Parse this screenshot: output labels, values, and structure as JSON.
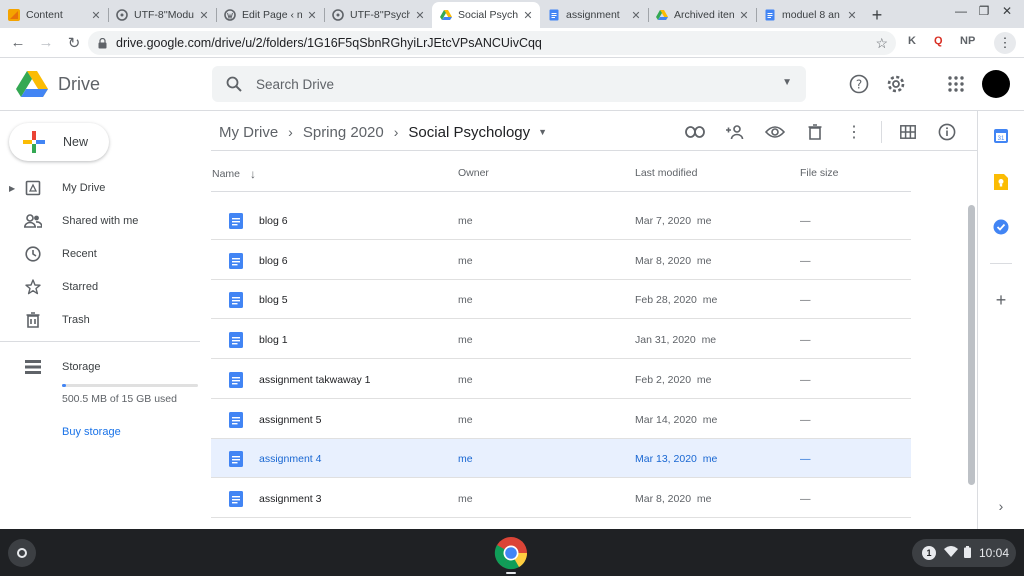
{
  "browser": {
    "tabs": [
      {
        "title": "Content",
        "icon": "sketch-icon",
        "active": false
      },
      {
        "title": "UTF-8''Modu",
        "icon": "canvas-icon",
        "active": false
      },
      {
        "title": "Edit Page ‹ n",
        "icon": "wordpress-icon",
        "active": false
      },
      {
        "title": "UTF-8''Psych",
        "icon": "canvas-icon",
        "active": false
      },
      {
        "title": "Social Psych",
        "icon": "drive-icon",
        "active": true
      },
      {
        "title": "assignment",
        "icon": "docs-icon",
        "active": false
      },
      {
        "title": "Archived iten",
        "icon": "drive-icon",
        "active": false
      },
      {
        "title": "moduel 8 an",
        "icon": "docs-icon",
        "active": false
      }
    ],
    "new_tab": "+",
    "url": "drive.google.com/drive/u/2/folders/1G16F5qSbnRGhyiLrJEtcVPsANCUivCqq",
    "extensions": [
      "K",
      "Q",
      "NP"
    ]
  },
  "drive": {
    "logo_text": "Drive",
    "search_placeholder": "Search Drive",
    "new_label": "New",
    "nav": [
      {
        "label": "My Drive",
        "icon": "my-drive-icon"
      },
      {
        "label": "Shared with me",
        "icon": "shared-icon"
      },
      {
        "label": "Recent",
        "icon": "clock-icon"
      },
      {
        "label": "Starred",
        "icon": "star-icon"
      },
      {
        "label": "Trash",
        "icon": "trash-icon"
      }
    ],
    "storage": {
      "label": "Storage",
      "used_text": "500.5 MB of 15 GB used",
      "used_fraction": 0.033,
      "buy_label": "Buy storage"
    },
    "breadcrumb": [
      "My Drive",
      "Spring 2020",
      "Social Psychology"
    ],
    "columns": {
      "name": "Name",
      "owner": "Owner",
      "modified": "Last modified",
      "size": "File size"
    },
    "files": [
      {
        "name": "blog 6",
        "owner": "me",
        "modified": "Mar 7, 2020",
        "modified_by": "me",
        "size": "—"
      },
      {
        "name": "blog 6",
        "owner": "me",
        "modified": "Mar 8, 2020",
        "modified_by": "me",
        "size": "—"
      },
      {
        "name": "blog 5",
        "owner": "me",
        "modified": "Feb 28, 2020",
        "modified_by": "me",
        "size": "—"
      },
      {
        "name": "blog 1",
        "owner": "me",
        "modified": "Jan 31, 2020",
        "modified_by": "me",
        "size": "—"
      },
      {
        "name": "assignment takwaway 1",
        "owner": "me",
        "modified": "Feb 2, 2020",
        "modified_by": "me",
        "size": "—"
      },
      {
        "name": "assignment 5",
        "owner": "me",
        "modified": "Mar 14, 2020",
        "modified_by": "me",
        "size": "—"
      },
      {
        "name": "assignment 4",
        "owner": "me",
        "modified": "Mar 13, 2020",
        "modified_by": "me",
        "size": "—",
        "selected": true
      },
      {
        "name": "assignment 3",
        "owner": "me",
        "modified": "Mar 8, 2020",
        "modified_by": "me",
        "size": "—"
      }
    ]
  },
  "shelf": {
    "notification_count": "1",
    "time": "10:04"
  },
  "colors": {
    "accent": "#1a73e8",
    "selected_row": "#e8f0fe",
    "docs_blue": "#4285f4"
  }
}
